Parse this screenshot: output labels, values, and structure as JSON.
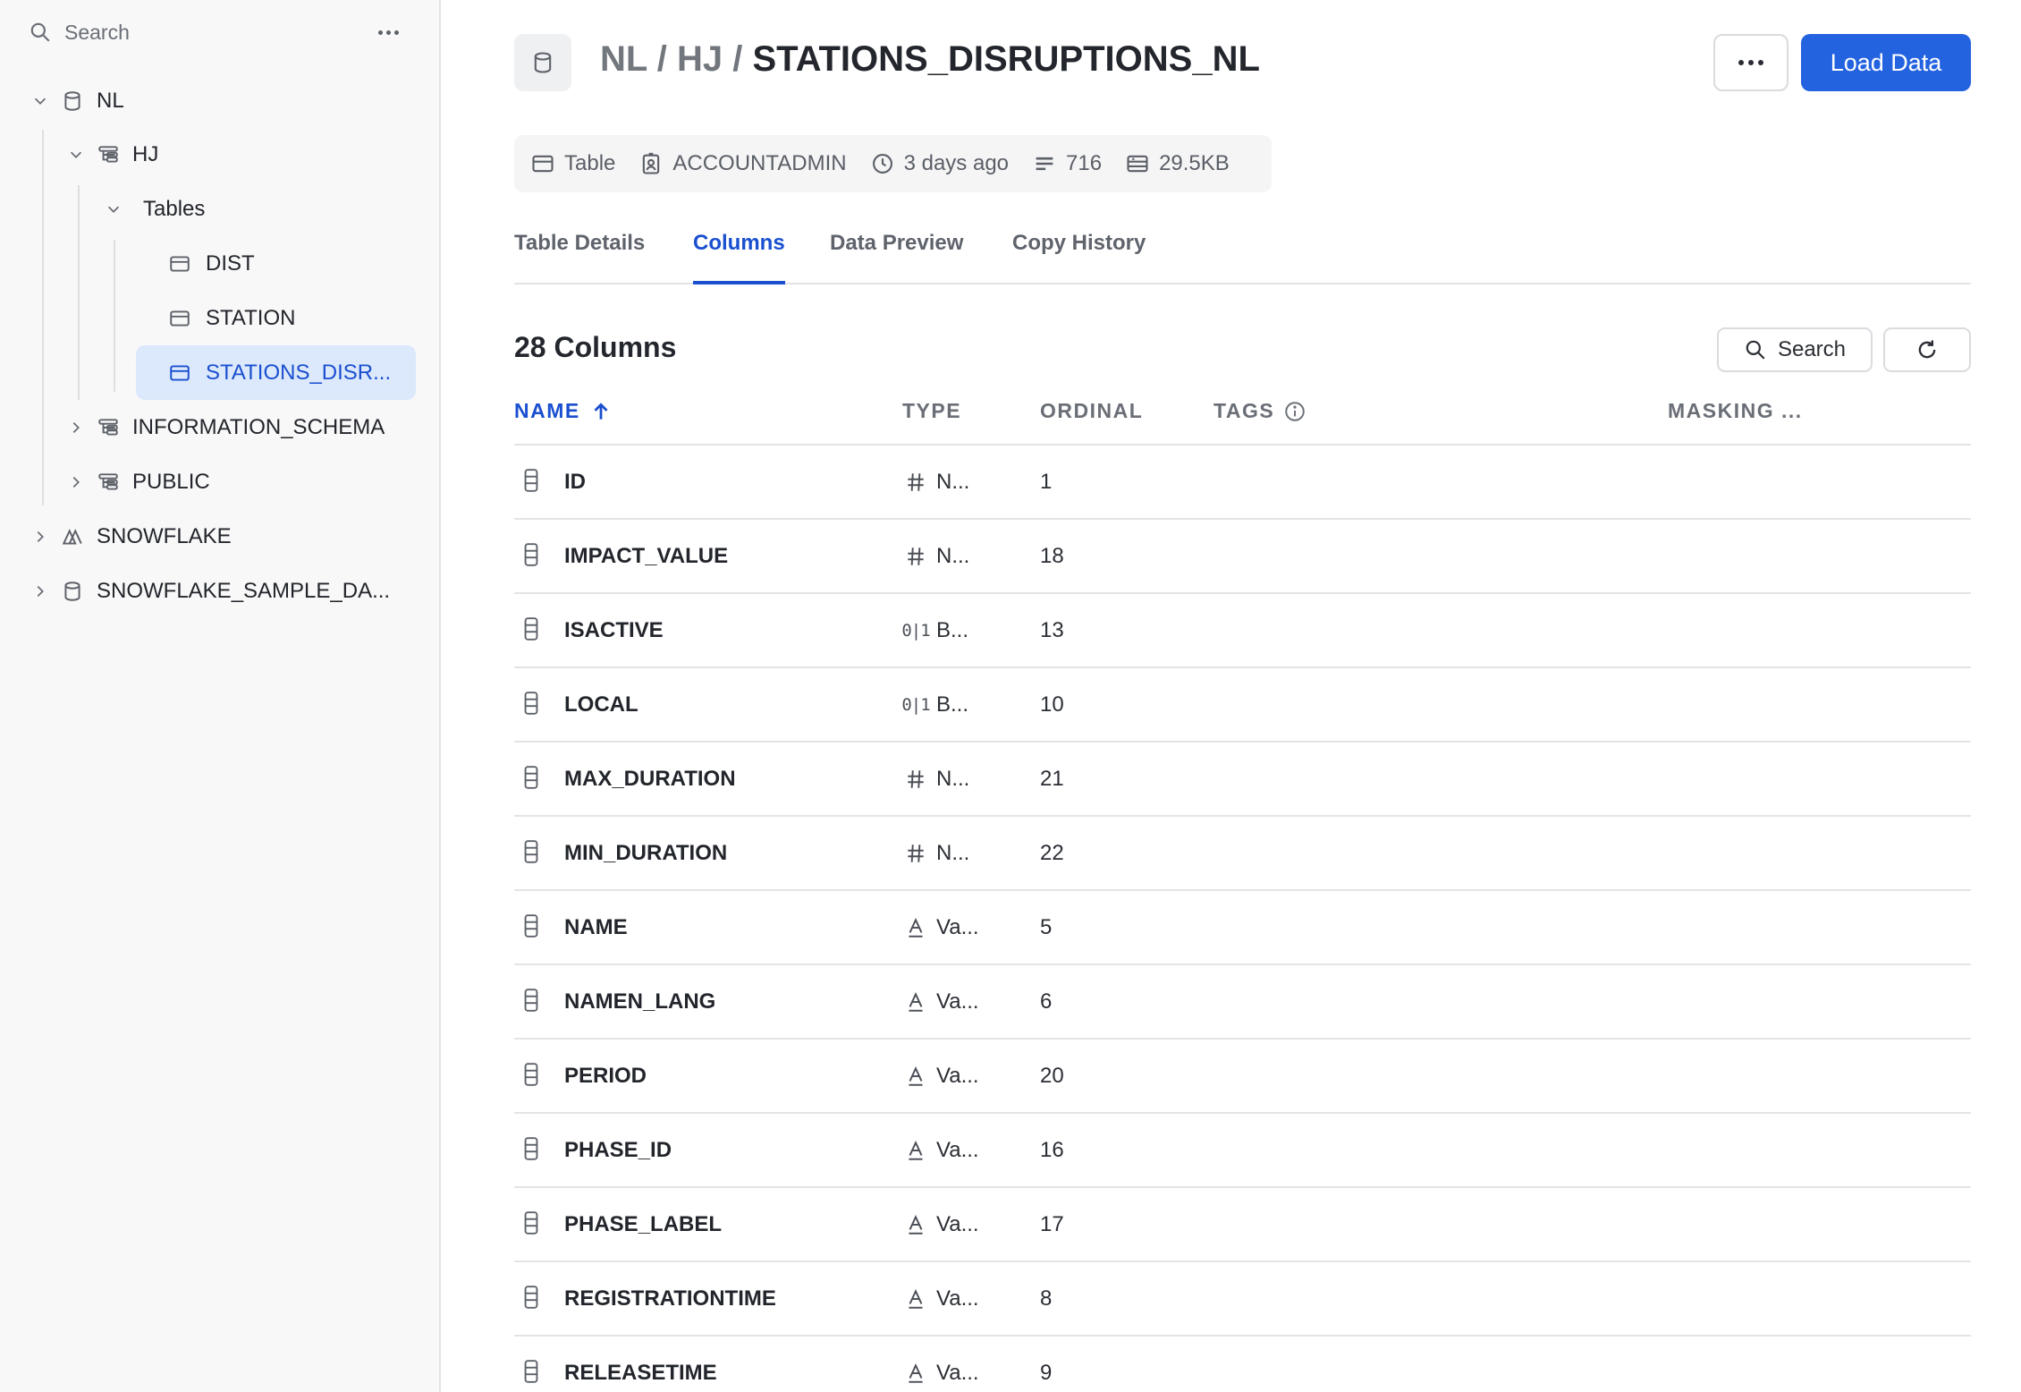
{
  "sidebar": {
    "search_placeholder": "Search",
    "tree": [
      {
        "label": "NL",
        "icon": "database-icon",
        "expanded": true
      },
      {
        "label": "HJ",
        "icon": "schema-icon",
        "expanded": true
      },
      {
        "label": "Tables",
        "icon": "",
        "expanded": true
      },
      {
        "label": "DIST",
        "icon": "table-icon"
      },
      {
        "label": "STATION",
        "icon": "table-icon"
      },
      {
        "label": "STATIONS_DISR...",
        "icon": "table-icon",
        "selected": true
      },
      {
        "label": "INFORMATION_SCHEMA",
        "icon": "schema-icon",
        "expanded": false
      },
      {
        "label": "PUBLIC",
        "icon": "schema-icon",
        "expanded": false
      },
      {
        "label": "SNOWFLAKE",
        "icon": "snowflake-db-icon",
        "expanded": false
      },
      {
        "label": "SNOWFLAKE_SAMPLE_DA...",
        "icon": "database-icon",
        "expanded": false
      }
    ]
  },
  "header": {
    "crumb_db": "NL",
    "crumb_sep1": " / ",
    "crumb_schema": "HJ",
    "crumb_sep2": " / ",
    "crumb_table": "STATIONS_DISRUPTIONS_NL",
    "load_button": "Load Data"
  },
  "meta": {
    "kind": "Table",
    "owner": "ACCOUNTADMIN",
    "modified": "3 days ago",
    "rows": "716",
    "size": "29.5KB"
  },
  "tabs": [
    "Table Details",
    "Columns",
    "Data Preview",
    "Copy History"
  ],
  "active_tab": "Columns",
  "columns_section": {
    "title": "28 Columns",
    "search_button": "Search",
    "headers": {
      "name": "NAME",
      "type": "TYPE",
      "ordinal": "ORDINAL",
      "tags": "TAGS",
      "masking": "MASKING ..."
    },
    "rows": [
      {
        "name": "ID",
        "type_icon": "number",
        "type": "N...",
        "ordinal": "1"
      },
      {
        "name": "IMPACT_VALUE",
        "type_icon": "number",
        "type": "N...",
        "ordinal": "18"
      },
      {
        "name": "ISACTIVE",
        "type_icon": "boolean",
        "type": "B...",
        "ordinal": "13"
      },
      {
        "name": "LOCAL",
        "type_icon": "boolean",
        "type": "B...",
        "ordinal": "10"
      },
      {
        "name": "MAX_DURATION",
        "type_icon": "number",
        "type": "N...",
        "ordinal": "21"
      },
      {
        "name": "MIN_DURATION",
        "type_icon": "number",
        "type": "N...",
        "ordinal": "22"
      },
      {
        "name": "NAME",
        "type_icon": "text",
        "type": "Va...",
        "ordinal": "5"
      },
      {
        "name": "NAMEN_LANG",
        "type_icon": "text",
        "type": "Va...",
        "ordinal": "6"
      },
      {
        "name": "PERIOD",
        "type_icon": "text",
        "type": "Va...",
        "ordinal": "20"
      },
      {
        "name": "PHASE_ID",
        "type_icon": "text",
        "type": "Va...",
        "ordinal": "16"
      },
      {
        "name": "PHASE_LABEL",
        "type_icon": "text",
        "type": "Va...",
        "ordinal": "17"
      },
      {
        "name": "REGISTRATIONTIME",
        "type_icon": "text",
        "type": "Va...",
        "ordinal": "8"
      },
      {
        "name": "RELEASETIME",
        "type_icon": "text",
        "type": "Va...",
        "ordinal": "9"
      }
    ]
  },
  "colors": {
    "accent": "#2463e0",
    "accent_text": "#1a4fd0",
    "selected_bg": "#dce8fb"
  }
}
